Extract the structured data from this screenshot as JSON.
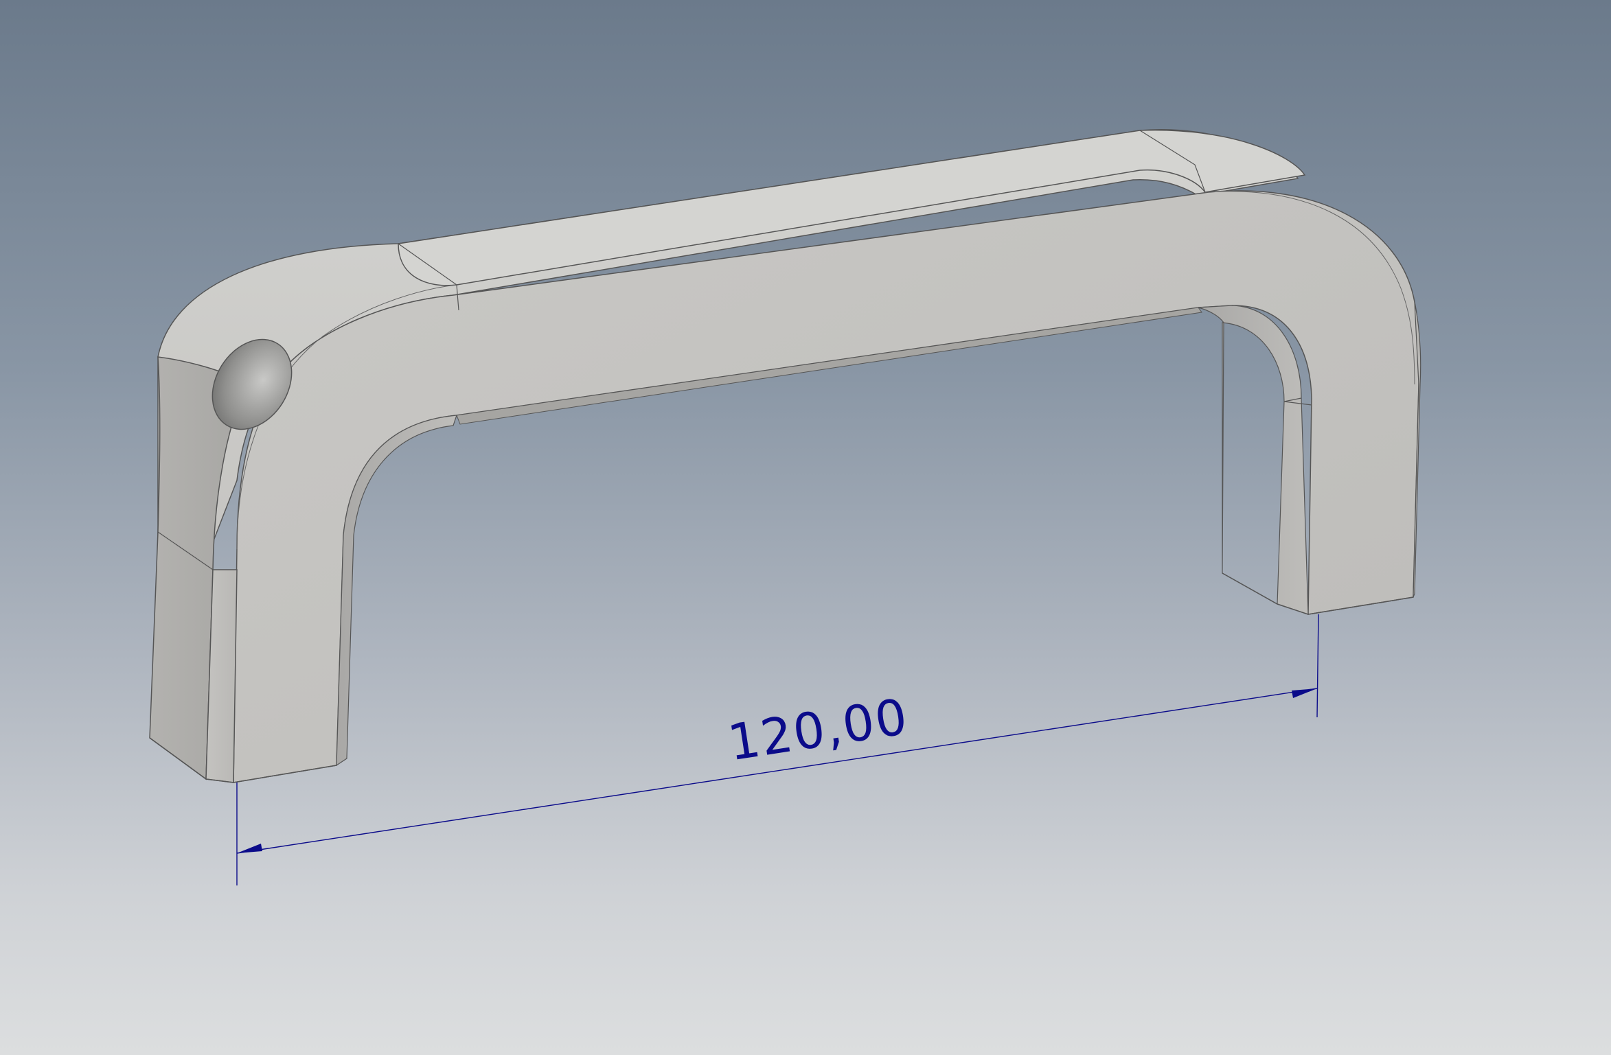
{
  "viewport": {
    "background_top": "#6b7a8b",
    "background_bottom": "#dcdedf"
  },
  "model": {
    "type": "U-shaped handle",
    "surface_color": "#c8c7c4",
    "edge_color": "#555555",
    "features": [
      "mounting-hole-left"
    ]
  },
  "dimension": {
    "value_text": "120,00",
    "color": "#0b0b8a"
  }
}
